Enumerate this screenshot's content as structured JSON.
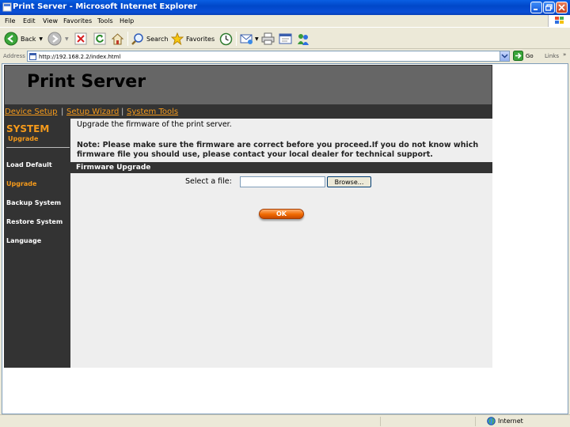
{
  "window": {
    "title": "Print Server - Microsoft Internet Explorer"
  },
  "menu": [
    "File",
    "Edit",
    "View",
    "Favorites",
    "Tools",
    "Help"
  ],
  "toolbar": {
    "back_label": "Back",
    "search_label": "Search",
    "favorites_label": "Favorites"
  },
  "address": {
    "label": "Address",
    "url": "http://192.168.2.2/index.html",
    "go_label": "Go",
    "links_label": "Links"
  },
  "page": {
    "header_title": "Print Server",
    "nav": {
      "device_setup": "Device Setup",
      "setup_wizard": "Setup Wizard",
      "system_tools": "System Tools",
      "sep1": "|",
      "sep2": "|"
    },
    "sidebar": {
      "section_title": "SYSTEM",
      "section_sub": "Upgrade",
      "items": [
        "Load Default",
        "Upgrade",
        "Backup System",
        "Restore System",
        "Language"
      ]
    },
    "main": {
      "intro": "Upgrade the firmware of the print server.",
      "note": "Note: Please make sure the firmware are correct before you proceed.If you do not know which firmware file you should use, please contact your local dealer for technical support.",
      "section_title": "Firmware Upgrade",
      "file_label": "Select a file:",
      "file_value": "",
      "browse_label": "Browse...",
      "ok_label": "OK"
    }
  },
  "status": {
    "zone": "Internet"
  }
}
